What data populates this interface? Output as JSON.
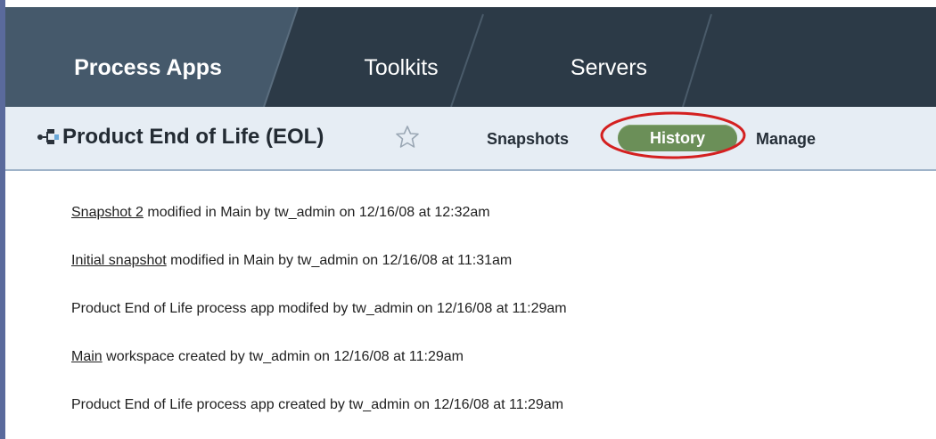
{
  "tabs": [
    {
      "label": "Process Apps",
      "active": true
    },
    {
      "label": "Toolkits",
      "active": false
    },
    {
      "label": "Servers",
      "active": false
    }
  ],
  "app": {
    "title": "Product End of Life (EOL)",
    "icon": "process-app-icon",
    "favorite_icon": "star-outline-icon"
  },
  "nav": {
    "snapshots": "Snapshots",
    "history": "History",
    "manage": "Manage",
    "active": "history"
  },
  "history": [
    {
      "link": "Snapshot 2",
      "text": " modified in Main by tw_admin on 12/16/08 at 12:32am"
    },
    {
      "link": "Initial snapshot",
      "text": " modified in Main by tw_admin on 12/16/08 at 11:31am"
    },
    {
      "link": "",
      "text": "Product End of Life process app modifed by tw_admin on 12/16/08 at 11:29am"
    },
    {
      "link": "Main",
      "text": " workspace created by tw_admin on 12/16/08 at 11:29am"
    },
    {
      "link": "",
      "text": "Product End of Life process app created by tw_admin on 12/16/08 at 11:29am"
    }
  ],
  "colors": {
    "tabbar": "#2c3a47",
    "active_tab": "#45596b",
    "subbar": "#e6edf4",
    "history_button": "#6b8f58",
    "annotation_ring": "#d42020"
  }
}
